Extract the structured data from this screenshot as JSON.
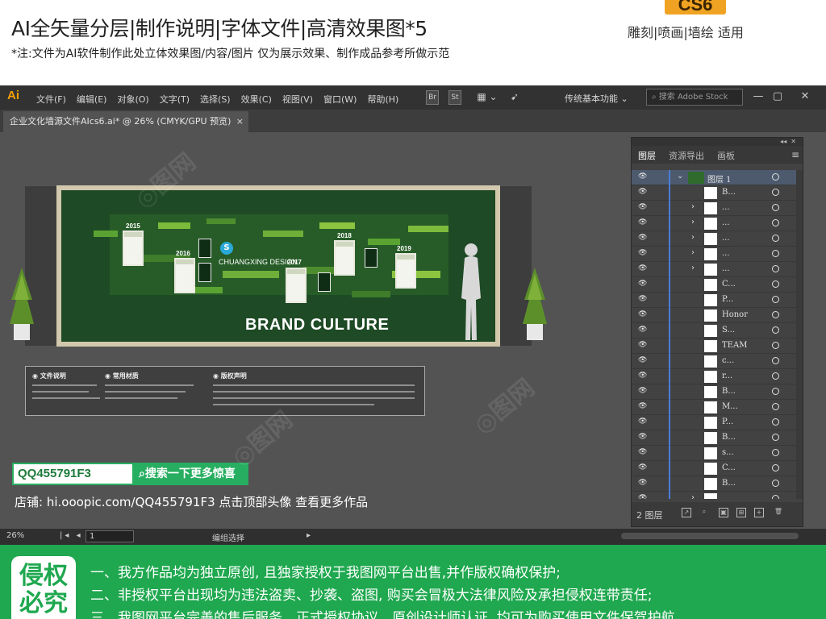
{
  "banner": {
    "title": "AI全矢量分层|制作说明|字体文件|高清效果图*5",
    "note": "*注:文件为AI软件制作此处立体效果图/内容/图片 仅为展示效果、制作成品参考所做示范",
    "version_badge": "CS6",
    "tags": "雕刻|喷画|墙绘 适用"
  },
  "app": {
    "logo": "Ai",
    "menus": [
      "文件(F)",
      "编辑(E)",
      "对象(O)",
      "文字(T)",
      "选择(S)",
      "效果(C)",
      "视图(V)",
      "窗口(W)",
      "帮助(H)"
    ],
    "br_label": "Br",
    "st_label": "St",
    "workspace": "传统基本功能",
    "search_placeholder": "搜索 Adobe Stock",
    "win_min": "—",
    "win_max": "▢",
    "win_close": "✕",
    "doc_tab": "企业文化墙源文件AIcs6.ai* @ 26% (CMYK/GPU 预览)",
    "doc_tab_close": "×"
  },
  "artwork": {
    "years": [
      "2015",
      "2016",
      "2017",
      "2018",
      "2019"
    ],
    "logo_mark": "S",
    "logo_text": "CHUANGXING DESIGN",
    "brand_text": "BRAND CULTURE"
  },
  "notes": {
    "col1_title": "文件说明",
    "col2_title": "常用材质",
    "col3_title": "版权声明"
  },
  "promo": {
    "qq": "QQ455791F3",
    "search_more": "搜索一下更多惊喜",
    "shop_line": "店铺: hi.ooopic.com/QQ455791F3 点击顶部头像 查看更多作品"
  },
  "layers_panel": {
    "collapse": "◂◂",
    "close": "✕",
    "tabs": [
      "图层",
      "资源导出",
      "画板"
    ],
    "menu_icon": "≡",
    "rows": [
      {
        "name": "图层 1",
        "expand": "⌄",
        "selected": true
      },
      {
        "name": "B...",
        "expand": ""
      },
      {
        "name": "...",
        "expand": "›"
      },
      {
        "name": "...",
        "expand": "›"
      },
      {
        "name": "...",
        "expand": "›"
      },
      {
        "name": "...",
        "expand": "›"
      },
      {
        "name": "...",
        "expand": "›"
      },
      {
        "name": "C...",
        "expand": ""
      },
      {
        "name": "P...",
        "expand": ""
      },
      {
        "name": "Honor",
        "expand": ""
      },
      {
        "name": "S...",
        "expand": ""
      },
      {
        "name": "TEAM",
        "expand": ""
      },
      {
        "name": "c...",
        "expand": ""
      },
      {
        "name": "r...",
        "expand": ""
      },
      {
        "name": "B...",
        "expand": ""
      },
      {
        "name": "M...",
        "expand": ""
      },
      {
        "name": "P...",
        "expand": ""
      },
      {
        "name": "B...",
        "expand": ""
      },
      {
        "name": "s...",
        "expand": ""
      },
      {
        "name": "C...",
        "expand": ""
      },
      {
        "name": "B...",
        "expand": ""
      },
      {
        "name": "...",
        "expand": "›"
      }
    ],
    "count": "2 图层"
  },
  "status": {
    "zoom": "26%",
    "page": "1",
    "mode": "编组选择",
    "arrows": "|◂ ◂",
    "arrows_right": "▸"
  },
  "footer": {
    "badge": "侵权必究",
    "lines": [
      "一、我方作品均为独立原创, 且独家授权于我图网平台出售,并作版权确权保护;",
      "二、非授权平台出现均为违法盗卖、抄袭、盗图, 购买会冒极大法律风险及承担侵权连带责任;",
      "三、我图网平台完善的售后服务、正式授权协议、原创设计师认证, 均可为购买使用文件保驾护航。"
    ]
  },
  "colors": {
    "brand_green": "#1fa84f",
    "ai_orange": "#f7a000",
    "cs6_orange": "#f0a322",
    "board_green": "#1e4a25"
  }
}
